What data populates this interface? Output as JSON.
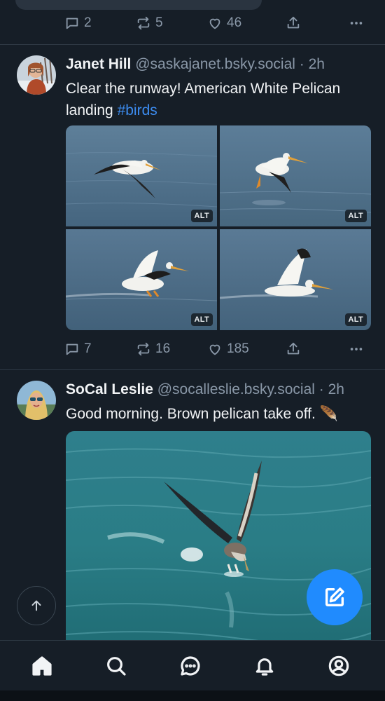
{
  "prev_post": {
    "reply_count": "2",
    "repost_count": "5",
    "like_count": "46"
  },
  "post1": {
    "display_name": "Janet Hill",
    "handle": "@saskajanet.bsky.social",
    "time": "· 2h",
    "text": "Clear the runway! American White Pelican landing ",
    "hashtag": "#birds",
    "images": [
      {
        "alt_badge": "ALT"
      },
      {
        "alt_badge": "ALT"
      },
      {
        "alt_badge": "ALT"
      },
      {
        "alt_badge": "ALT"
      }
    ],
    "reply_count": "7",
    "repost_count": "16",
    "like_count": "185"
  },
  "post2": {
    "display_name": "SoCal Leslie",
    "handle": "@socalleslie.bsky.social",
    "time": "· 2h",
    "text": "Good morning.  Brown pelican take off. 🪶"
  },
  "icons": {
    "reply": "reply-icon",
    "repost": "repost-icon",
    "like": "heart-icon",
    "share": "share-icon",
    "more": "more-icon",
    "scroll_top": "arrow-up-icon",
    "compose": "compose-icon",
    "nav": [
      "home-icon",
      "search-icon",
      "chat-icon",
      "bell-icon",
      "profile-icon"
    ]
  },
  "colors": {
    "background": "#161e27",
    "accent": "#208bfe",
    "link": "#3c8cf0",
    "muted": "#8a98a8"
  }
}
